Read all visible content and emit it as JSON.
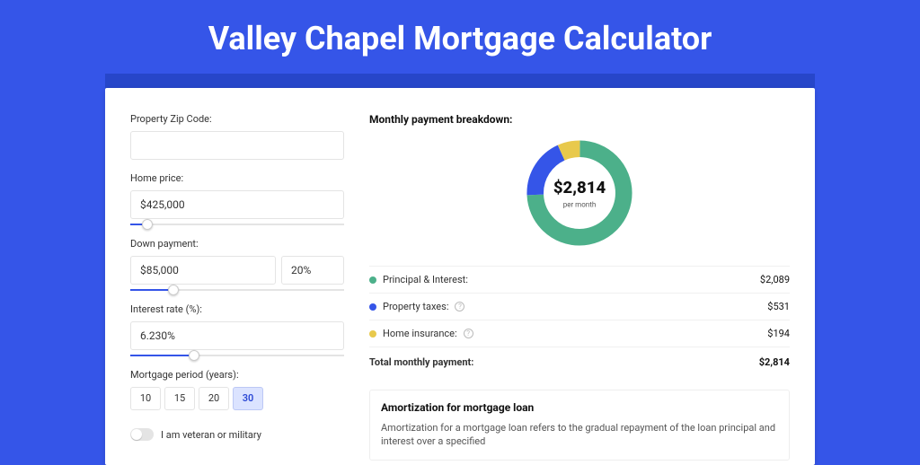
{
  "page": {
    "title": "Valley Chapel Mortgage Calculator"
  },
  "form": {
    "zip_label": "Property Zip Code:",
    "zip_value": "",
    "home_price_label": "Home price:",
    "home_price_value": "$425,000",
    "home_price_slider_pct": 8,
    "down_payment_label": "Down payment:",
    "down_payment_value": "$85,000",
    "down_payment_pct": "20%",
    "down_payment_slider_pct": 20,
    "interest_label": "Interest rate (%):",
    "interest_value": "6.230%",
    "interest_slider_pct": 30,
    "period_label": "Mortgage period (years):",
    "period_options": {
      "p10": "10",
      "p15": "15",
      "p20": "20",
      "p30": "30"
    },
    "period_selected": "30",
    "veteran_label": "I am veteran or military"
  },
  "breakdown": {
    "title": "Monthly payment breakdown:",
    "center_amount": "$2,814",
    "center_sub": "per month",
    "rows": {
      "pi_label": "Principal & Interest:",
      "pi_value": "$2,089",
      "tax_label": "Property taxes:",
      "tax_value": "$531",
      "ins_label": "Home insurance:",
      "ins_value": "$194",
      "total_label": "Total monthly payment:",
      "total_value": "$2,814"
    }
  },
  "amort": {
    "title": "Amortization for mortgage loan",
    "text": "Amortization for a mortgage loan refers to the gradual repayment of the loan principal and interest over a specified"
  },
  "chart_data": {
    "type": "pie",
    "title": "Monthly payment breakdown",
    "series": [
      {
        "name": "Principal & Interest",
        "value": 2089,
        "color": "#4cb08a"
      },
      {
        "name": "Property taxes",
        "value": 531,
        "color": "#3555e8"
      },
      {
        "name": "Home insurance",
        "value": 194,
        "color": "#e8c94c"
      }
    ],
    "total": 2814
  }
}
